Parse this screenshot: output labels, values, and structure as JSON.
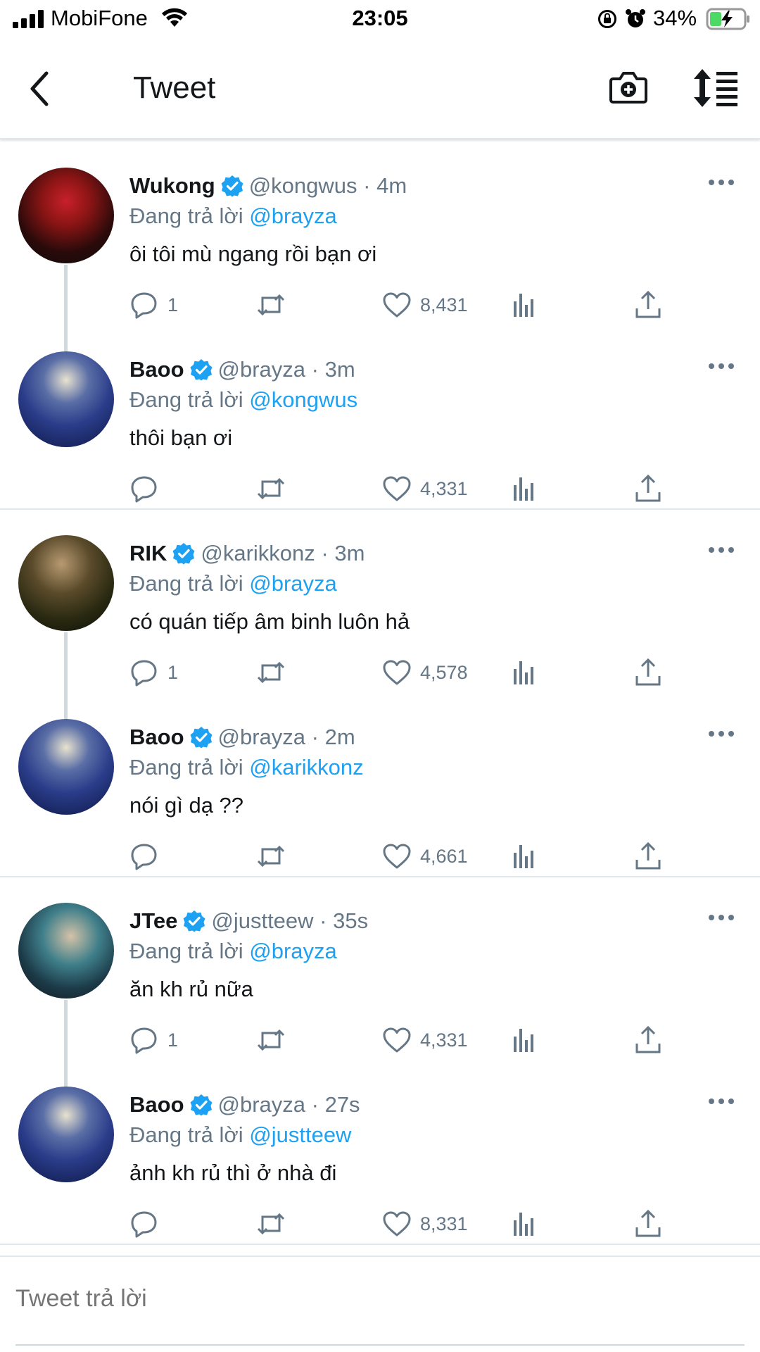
{
  "status_bar": {
    "carrier": "MobiFone",
    "time": "23:05",
    "battery": "34%",
    "battery_level": 0.34,
    "icons": [
      "signal-icon",
      "wifi-icon",
      "rotation-lock-icon",
      "alarm-icon",
      "battery-charging-icon"
    ]
  },
  "header": {
    "title": "Tweet",
    "icons": [
      "back-chevron-icon",
      "camera-plus-icon",
      "sort-icon"
    ]
  },
  "colors": {
    "link": "#1da1f2",
    "secondary_text": "#657786",
    "primary_text": "#14171a",
    "divider": "#e1e8ed",
    "verified": "#1da1f2"
  },
  "reply_prefix": "Đang trả lời",
  "tweets": [
    {
      "name": "Wukong",
      "handle": "@kongwus",
      "time": "4m",
      "reply_to": "@brayza",
      "text": "ôi tôi mù ngang rồi bạn ơi",
      "replies": "1",
      "retweets": "",
      "likes": "8,431"
    },
    {
      "name": "Baoo",
      "handle": "@brayza",
      "time": "3m",
      "reply_to": "@kongwus",
      "text": "thôi bạn ơi",
      "replies": "",
      "retweets": "",
      "likes": "4,331"
    },
    {
      "name": "RIK",
      "handle": "@karikkonz",
      "time": "3m",
      "reply_to": "@brayza",
      "text": "có quán tiếp âm binh luôn hả",
      "replies": "1",
      "retweets": "",
      "likes": "4,578"
    },
    {
      "name": "Baoo",
      "handle": "@brayza",
      "time": "2m",
      "reply_to": "@karikkonz",
      "text": "nói gì dạ ??",
      "replies": "",
      "retweets": "",
      "likes": "4,661"
    },
    {
      "name": "JTee",
      "handle": "@justteew",
      "time": "35s",
      "reply_to": "@brayza",
      "text": "ăn kh rủ nữa",
      "replies": "1",
      "retweets": "",
      "likes": "4,331"
    },
    {
      "name": "Baoo",
      "handle": "@brayza",
      "time": "27s",
      "reply_to": "@justteew",
      "text": "ảnh kh rủ thì ở nhà đi",
      "replies": "",
      "retweets": "",
      "likes": "8,331"
    }
  ],
  "reply_bar": {
    "placeholder": "Tweet trả lời"
  }
}
